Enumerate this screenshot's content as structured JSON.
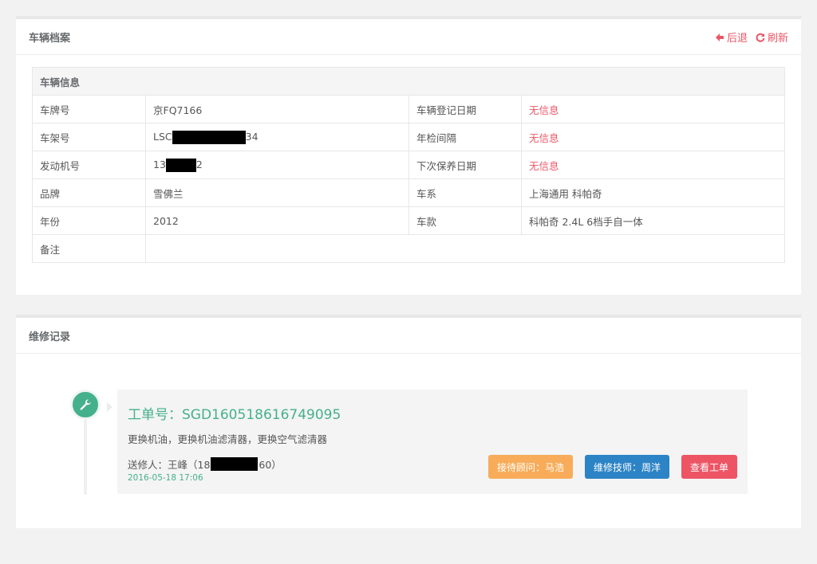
{
  "vehicle_panel": {
    "title": "车辆档案",
    "back_label": "后退",
    "refresh_label": "刷新",
    "section_title": "车辆信息",
    "rows": [
      {
        "l1": "车牌号",
        "v1": "京FQ7166",
        "l2": "车辆登记日期",
        "v2": "无信息"
      },
      {
        "l1": "车架号",
        "v1_pre": "LSC",
        "v1_post": "34",
        "l2": "年检间隔",
        "v2": "无信息"
      },
      {
        "l1": "发动机号",
        "v1_pre": "13",
        "v1_post": "2",
        "l2": "下次保养日期",
        "v2": "无信息"
      },
      {
        "l1": "品牌",
        "v1": "雪佛兰",
        "l2": "车系",
        "v2": "上海通用 科帕奇"
      },
      {
        "l1": "年份",
        "v1": "2012",
        "l2": "车款",
        "v2": "科帕奇 2.4L 6档手自一体"
      },
      {
        "l1": "备注",
        "v1": ""
      }
    ]
  },
  "repair_panel": {
    "title": "维修记录",
    "record": {
      "order_label": "工单号：SGD160518616749095",
      "description": "更换机油，更换机油滤清器，更换空气滤清器",
      "sender_pre": "送修人：王峰（18",
      "sender_post": "60）",
      "time": "2016-05-18 17:06",
      "advisor_button": "接待顾问：马浩",
      "tech_button": "维修技师：周洋",
      "view_button": "查看工单"
    }
  },
  "colors": {
    "accent_green": "#45b08c",
    "danger_red": "#ed5565",
    "warning_orange": "#f8ac59",
    "primary_blue": "#2c83c5"
  }
}
